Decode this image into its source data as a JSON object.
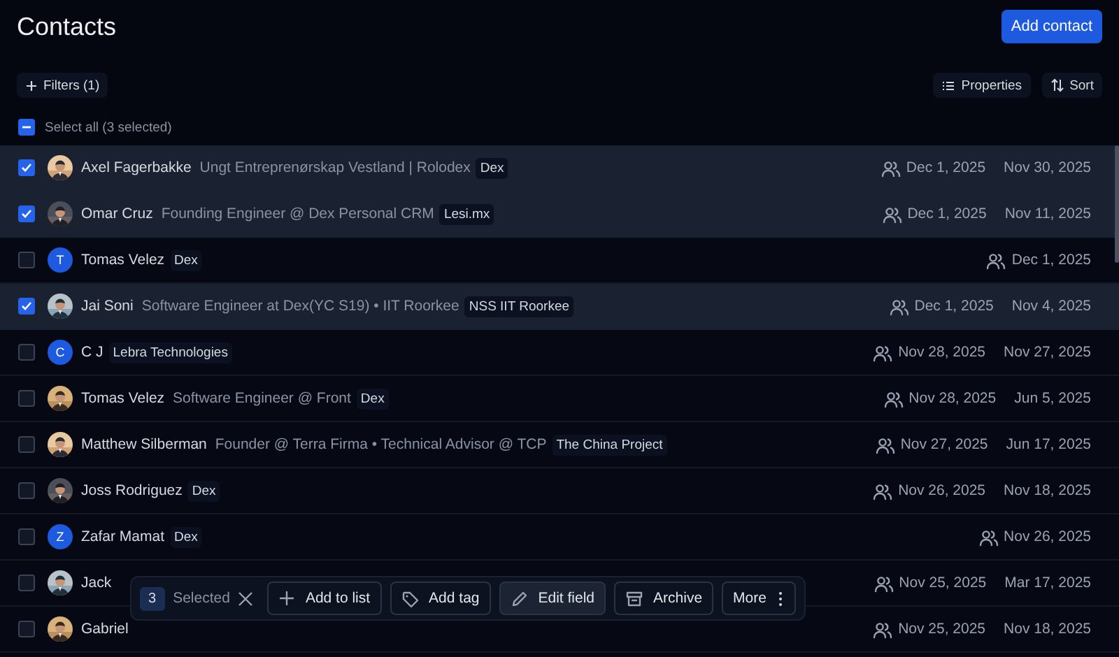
{
  "title": "Contacts",
  "add_button": "Add contact",
  "filters_button": "Filters (1)",
  "properties_button": "Properties",
  "sort_button": "Sort",
  "select_all": {
    "label": "Select all (3 selected)",
    "indeterminate": true
  },
  "rows": [
    {
      "name": "Axel Fagerbakke",
      "title": "Ungt Entreprenørskap Vestland | Rolodex",
      "tag": "Dex",
      "checked": true,
      "date_1": "Dec 1, 2025",
      "date_2": "Nov 30, 2025"
    },
    {
      "name": "Omar Cruz",
      "title": "Founding Engineer @ Dex Personal CRM",
      "tag": "Lesi.mx",
      "checked": true,
      "date_1": "Dec 1, 2025",
      "date_2": "Nov 11, 2025"
    },
    {
      "avatar": {
        "kind": "letter",
        "letter": "T"
      },
      "name": "Tomas Velez",
      "tag": "Dex",
      "checked": false,
      "date_1": "Dec 1, 2025"
    },
    {
      "name": "Jai Soni",
      "title": "Software Engineer at Dex(YC S19) • IIT Roorkee",
      "tag": "NSS IIT Roorkee",
      "checked": true,
      "date_1": "Dec 1, 2025",
      "date_2": "Nov 4, 2025"
    },
    {
      "avatar": {
        "kind": "letter",
        "letter": "C"
      },
      "name": "C J",
      "tag": "Lebra Technologies",
      "checked": false,
      "date_1": "Nov 28, 2025",
      "date_2": "Nov 27, 2025"
    },
    {
      "name": "Tomas Velez",
      "title": "Software Engineer @ Front",
      "tag": "Dex",
      "checked": false,
      "date_1": "Nov 28, 2025",
      "date_2": "Jun 5, 2025"
    },
    {
      "name": "Matthew Silberman",
      "title": "Founder @ Terra Firma • Technical Advisor @ TCP",
      "tag": "The China Project",
      "checked": false,
      "date_1": "Nov 27, 2025",
      "date_2": "Jun 17, 2025"
    },
    {
      "name": "Joss Rodriguez",
      "tag": "Dex",
      "checked": false,
      "date_1": "Nov 26, 2025",
      "date_2": "Nov 18, 2025"
    },
    {
      "avatar": {
        "kind": "letter",
        "letter": "Z"
      },
      "name": "Zafar Mamat",
      "tag": "Dex",
      "checked": false,
      "date_1": "Nov 26, 2025"
    },
    {
      "name": "Jack",
      "checked": false,
      "date_1": "Nov 25, 2025",
      "date_2": "Mar 17, 2025"
    },
    {
      "name": "Gabriel",
      "checked": false,
      "date_1": "Nov 25, 2025",
      "date_2": "Nov 18, 2025"
    }
  ],
  "bulk_bar": {
    "count": "3",
    "label": "Selected",
    "actions": [
      {
        "label": "Add to list",
        "selected": false
      },
      {
        "label": "Add tag",
        "selected": false
      },
      {
        "label": "Edit field",
        "selected": true
      },
      {
        "label": "Archive",
        "selected": false
      },
      {
        "label": "More",
        "selected": false
      }
    ]
  }
}
